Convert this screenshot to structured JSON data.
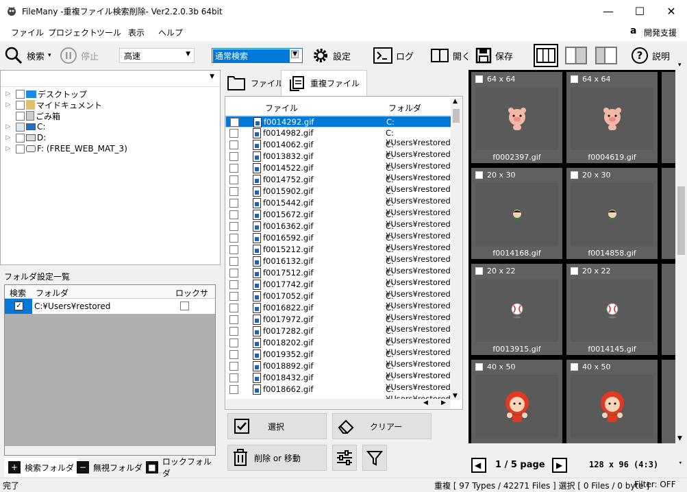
{
  "window": {
    "title": "FileMany -重複ファイル検索削除- Ver2.2.0.3b 64bit"
  },
  "menu": [
    "ファイル",
    "プロジェクト",
    "ツール",
    "表示",
    "ヘルプ"
  ],
  "support_label": "開発支援",
  "toolbar": {
    "search": "検索",
    "stop": "停止",
    "speed": "高速",
    "mode": "通常検索",
    "settings": "設定",
    "log": "ログ",
    "open": "開く",
    "save": "保存",
    "help": "説明"
  },
  "tree": [
    {
      "label": "デスクトップ"
    },
    {
      "label": "マイドキュメント"
    },
    {
      "label": "ごみ箱"
    },
    {
      "label": "C:"
    },
    {
      "label": "D:"
    },
    {
      "label": "F: (FREE_WEB_MAT_3)"
    }
  ],
  "folder_list": {
    "label": "フォルダ設定一覧",
    "cols": [
      "検索",
      "フォルダ",
      "ロック",
      "サブ"
    ],
    "row": {
      "folder": "C:¥Users¥restored"
    }
  },
  "bottom_tabs": [
    "検索フォルダ",
    "無視フォルダ",
    "ロックフォルダ"
  ],
  "file_tabs": [
    "ファイル",
    "重複ファイル"
  ],
  "file_list": {
    "cols": [
      "ファイル",
      "フォルダ"
    ],
    "rows": [
      {
        "name": "f0014292.gif",
        "folder": "C:¥Users¥restored"
      },
      {
        "name": "f0014982.gif",
        "folder": "C:¥Users¥restored"
      },
      {
        "name": "f0014062.gif",
        "folder": "C:¥Users¥restored"
      },
      {
        "name": "f0013832.gif",
        "folder": "C:¥Users¥restored"
      },
      {
        "name": "f0014522.gif",
        "folder": "C:¥Users¥restored"
      },
      {
        "name": "f0014752.gif",
        "folder": "C:¥Users¥restored"
      },
      {
        "name": "f0015902.gif",
        "folder": "C:¥Users¥restored"
      },
      {
        "name": "f0015442.gif",
        "folder": "C:¥Users¥restored"
      },
      {
        "name": "f0015672.gif",
        "folder": "C:¥Users¥restored"
      },
      {
        "name": "f0016362.gif",
        "folder": "C:¥Users¥restored"
      },
      {
        "name": "f0016592.gif",
        "folder": "C:¥Users¥restored"
      },
      {
        "name": "f0015212.gif",
        "folder": "C:¥Users¥restored"
      },
      {
        "name": "f0016132.gif",
        "folder": "C:¥Users¥restored"
      },
      {
        "name": "f0017512.gif",
        "folder": "C:¥Users¥restored"
      },
      {
        "name": "f0017742.gif",
        "folder": "C:¥Users¥restored"
      },
      {
        "name": "f0017052.gif",
        "folder": "C:¥Users¥restored"
      },
      {
        "name": "f0016822.gif",
        "folder": "C:¥Users¥restored"
      },
      {
        "name": "f0017972.gif",
        "folder": "C:¥Users¥restored"
      },
      {
        "name": "f0017282.gif",
        "folder": "C:¥Users¥restored"
      },
      {
        "name": "f0018202.gif",
        "folder": "C:¥Users¥restored"
      },
      {
        "name": "f0019352.gif",
        "folder": "C:¥Users¥restored"
      },
      {
        "name": "f0018892.gif",
        "folder": "C:¥Users¥restored"
      },
      {
        "name": "f0018432.gif",
        "folder": "C:¥Users¥restored"
      },
      {
        "name": "f0018662.gif",
        "folder": "C:¥Users¥restored"
      }
    ]
  },
  "actions": {
    "select": "選択",
    "clear": "クリアー",
    "delete": "削除 or 移動"
  },
  "preview": [
    {
      "size": "64 x 64",
      "name": "f0002397.gif",
      "art": "pig"
    },
    {
      "size": "64 x 64",
      "name": "f0004619.gif",
      "art": "pig"
    },
    {
      "size": "20 x 30",
      "name": "f0014168.gif",
      "art": "face"
    },
    {
      "size": "20 x 30",
      "name": "f0014858.gif",
      "art": "face"
    },
    {
      "size": "20 x 22",
      "name": "f0013915.gif",
      "art": "ball"
    },
    {
      "size": "20 x 22",
      "name": "f0014145.gif",
      "art": "ball"
    },
    {
      "size": "40 x 50",
      "name": "",
      "art": "girl"
    },
    {
      "size": "40 x 50",
      "name": "",
      "art": "girl"
    }
  ],
  "pager": {
    "page": "1 / 5 page",
    "thumb_size": "128 x 96 (4:3)"
  },
  "status": {
    "left": "完了",
    "counts": "重複 [ 97 Types / 42271 Files ]  選択 [ 0 Files / 0 byte ]",
    "filter": "Filter: OFF"
  },
  "colors": {
    "selection": "#0078d7",
    "preview_bg": "#000000",
    "tile_bg": "#606060"
  }
}
